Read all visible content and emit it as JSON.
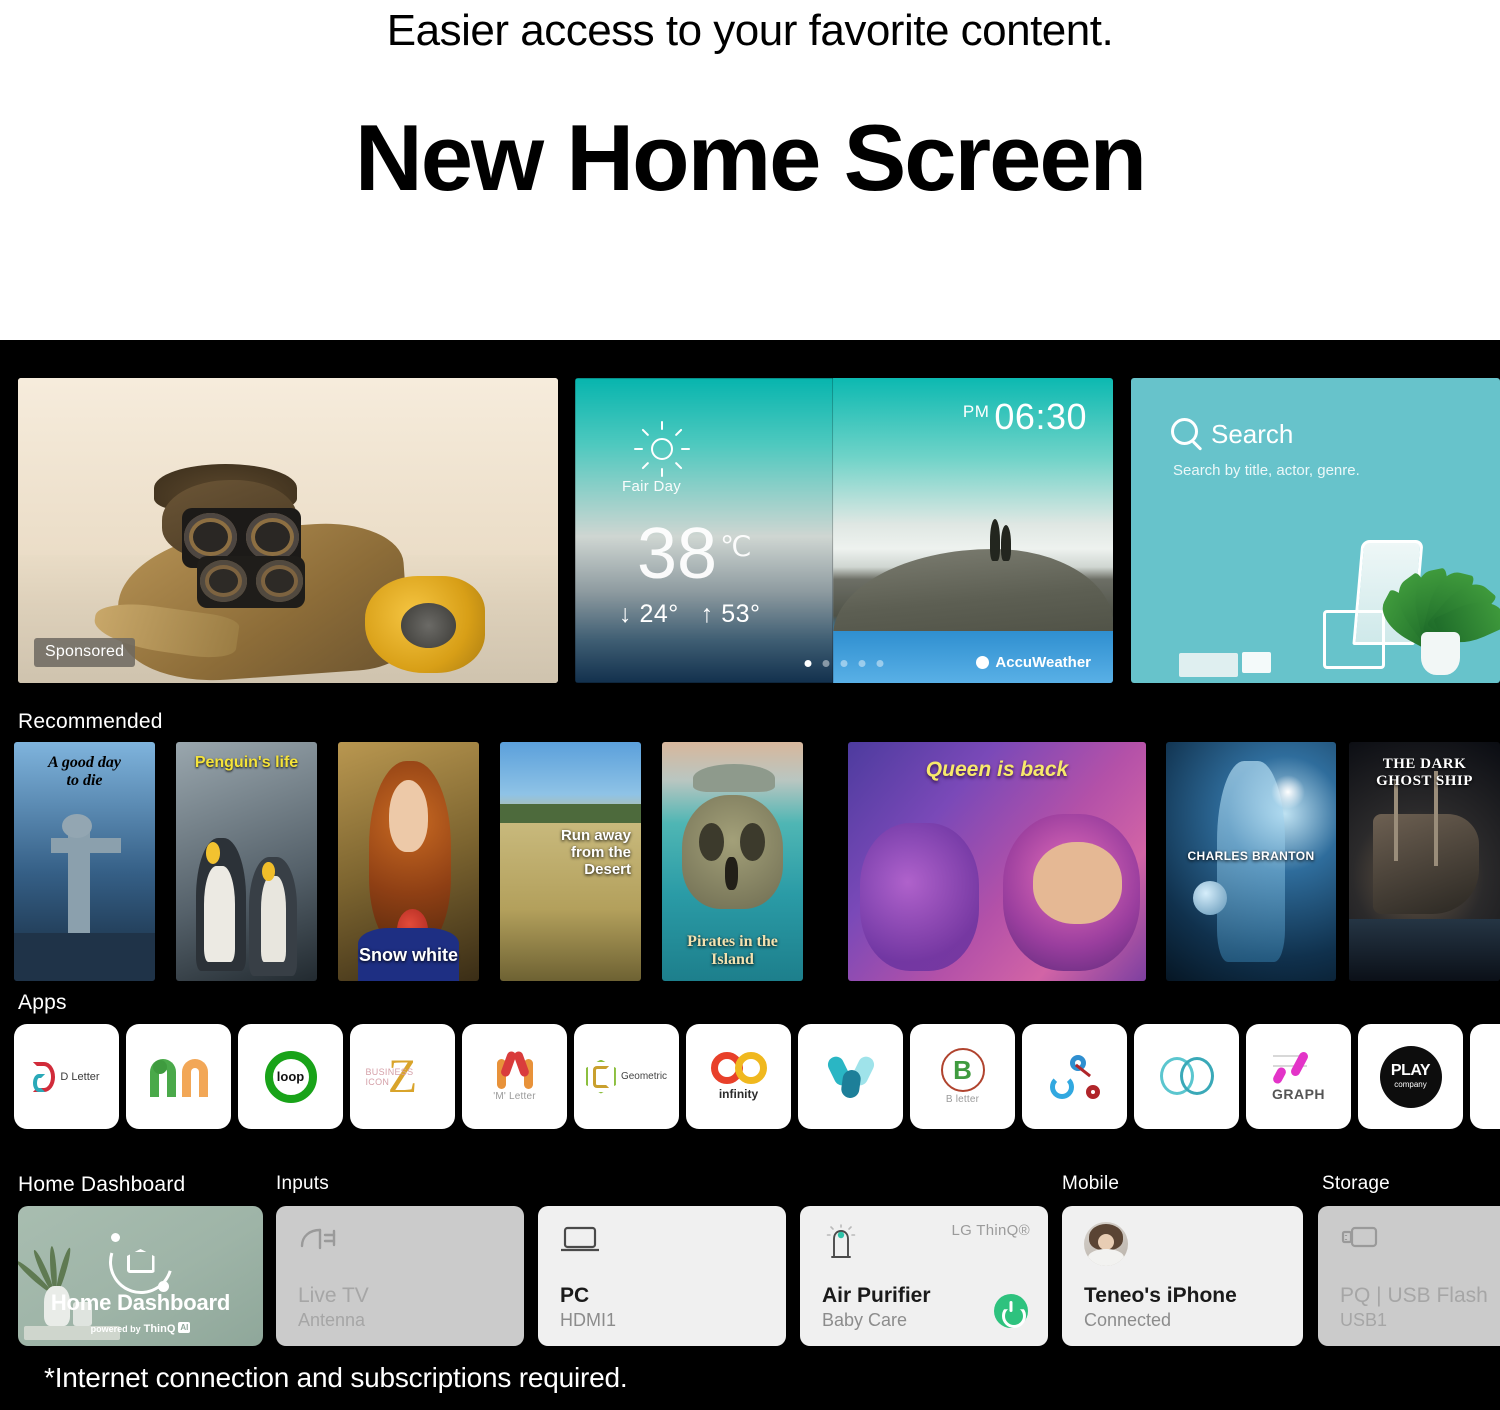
{
  "header": {
    "subheadline": "Easier access to your favorite content.",
    "headline": "New Home Screen"
  },
  "hero": {
    "sponsored_badge": "Sponsored"
  },
  "weather": {
    "condition": "Fair Day",
    "temperature": "38",
    "unit": "℃",
    "low": "↓ 24°",
    "high": "↑ 53°",
    "ampm": "PM",
    "time": "06:30",
    "provider": "AccuWeather",
    "dot_count": 5,
    "active_dot": 0
  },
  "search": {
    "title": "Search",
    "subtitle": "Search by title, actor, genre."
  },
  "sections": {
    "recommended": "Recommended",
    "apps": "Apps",
    "home_dashboard": "Home Dashboard",
    "inputs": "Inputs",
    "mobile": "Mobile",
    "storage": "Storage"
  },
  "recommended": [
    {
      "title": "A good day\nto die",
      "color": "#ffffff"
    },
    {
      "title": "Penguin's life",
      "color": "#f5e33a"
    },
    {
      "title": "Snow white",
      "color": "#ffffff"
    },
    {
      "title": "Run away\nfrom the\nDesert",
      "color": "#ffffff"
    },
    {
      "title": "Pirates in the\nIsland",
      "color": "#f3e2b0"
    },
    {
      "title": "Queen is back",
      "color": "#f7e96b"
    },
    {
      "title": "CHARLES BRANTON",
      "color": "#ffffff"
    },
    {
      "title": "THE DARK\nGHOST SHIP",
      "color": "#ffffff"
    }
  ],
  "apps": [
    {
      "name": "d-letter-app",
      "caption": "D Letter"
    },
    {
      "name": "m-monogram-app",
      "caption": ""
    },
    {
      "name": "loop-app",
      "caption": "loop"
    },
    {
      "name": "business-icon-app",
      "caption": "BUSINESS ICON"
    },
    {
      "name": "m-letter-app",
      "caption": "'M' Letter"
    },
    {
      "name": "geometric-app",
      "caption": "Geometric"
    },
    {
      "name": "infinity-app",
      "caption": "infinity"
    },
    {
      "name": "v-leaf-app",
      "caption": ""
    },
    {
      "name": "b-letter-app",
      "caption": "B letter"
    },
    {
      "name": "molecule-app",
      "caption": ""
    },
    {
      "name": "rings-app",
      "caption": ""
    },
    {
      "name": "graph-app",
      "caption": "GRAPH"
    },
    {
      "name": "play-company-app",
      "caption": ""
    },
    {
      "name": "partial-app",
      "caption": ""
    }
  ],
  "dashboard": {
    "home": {
      "label": "Home Dashboard",
      "powered_prefix": "powered by",
      "powered_brand": "ThinQ",
      "powered_badge": "AI"
    },
    "tiles": [
      {
        "name": "live-tv-tile",
        "title": "Live TV",
        "sub": "Antenna",
        "icon": "plug-icon",
        "style": "grey"
      },
      {
        "name": "pc-tile",
        "title": "PC",
        "sub": "HDMI1",
        "icon": "laptop-icon",
        "style": "light"
      },
      {
        "name": "air-purifier-tile",
        "title": "Air Purifier",
        "sub": "Baby Care",
        "icon": "purifier-icon",
        "style": "light",
        "brand": "LG ThinQ®",
        "power": true
      },
      {
        "name": "iphone-tile",
        "title": "Teneo's iPhone",
        "sub": "Connected",
        "icon": "avatar-icon",
        "style": "light"
      },
      {
        "name": "usb-tile",
        "title": "PQ | USB Flash",
        "sub": "USB1",
        "icon": "usb-icon",
        "style": "grey"
      }
    ]
  },
  "footer": {
    "disclaimer": "*Internet connection and subscriptions required."
  },
  "colors": {
    "screen_bg": "#000000",
    "search_card": "#67c3cb",
    "home_dashboard_tile": "#9eb4a7",
    "power_on": "#2ec27e",
    "tile_grey": "#cbcbcb",
    "tile_light": "#f0f0f0"
  }
}
